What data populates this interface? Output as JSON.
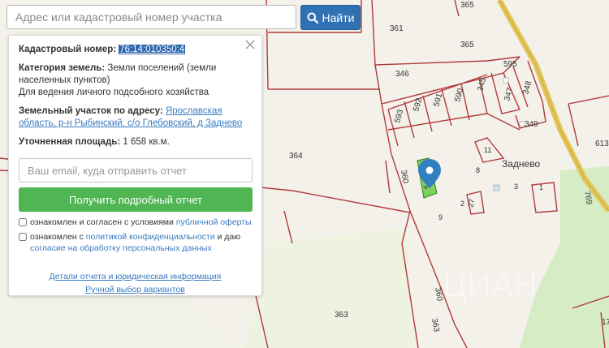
{
  "search": {
    "placeholder": "Адрес или кадастровый номер участка",
    "button_label": "Найти"
  },
  "info": {
    "cadastral_label": "Кадастровый номер:",
    "cadastral_number": "76:14:010350:4",
    "category_label": "Категория земель:",
    "category_value": "Земли поселений (земли населенных пунктов)",
    "purpose": "Для ведения личного подсобного хозяйства",
    "address_label": "Земельный участок по адресу:",
    "address_value": "Ярославская область, р-н Рыбинский, с/о Глебовский, д Заднево",
    "area_label": "Уточненная площадь:",
    "area_value": "1 658 кв.м."
  },
  "form": {
    "email_placeholder": "Ваш email, куда отправить отчет",
    "submit_label": "Получить подробный отчет",
    "consent1_text": "ознакомлен и согласен с условиями ",
    "consent1_link": "публичной оферты",
    "consent2_text_a": "ознакомлен с ",
    "consent2_link_a": "политикой конфиденциальности",
    "consent2_text_b": " и даю ",
    "consent2_link_b": "согласие на обработку персональных данных"
  },
  "footer": {
    "details_link": "Детали отчета и юридическая информация",
    "manual_link": "Ручной выбор вариантов"
  },
  "map": {
    "village_label": "Заднево",
    "parcels": [
      "361",
      "365",
      "365",
      "346",
      "595",
      "592",
      "591",
      "590",
      "345",
      "347",
      "348",
      "349",
      "593",
      "364",
      "360",
      "4",
      "8",
      "11",
      "3",
      "1",
      "9",
      "27",
      "2",
      "363",
      "360",
      "363",
      "613",
      "769",
      "17"
    ],
    "watermark": "ЦИАН"
  },
  "colors": {
    "accent": "#3071b4",
    "submit": "#4fb653",
    "boundary": "#b23a3a",
    "selected_parcel": "#7ed15a",
    "marker": "#2f7fc1"
  }
}
